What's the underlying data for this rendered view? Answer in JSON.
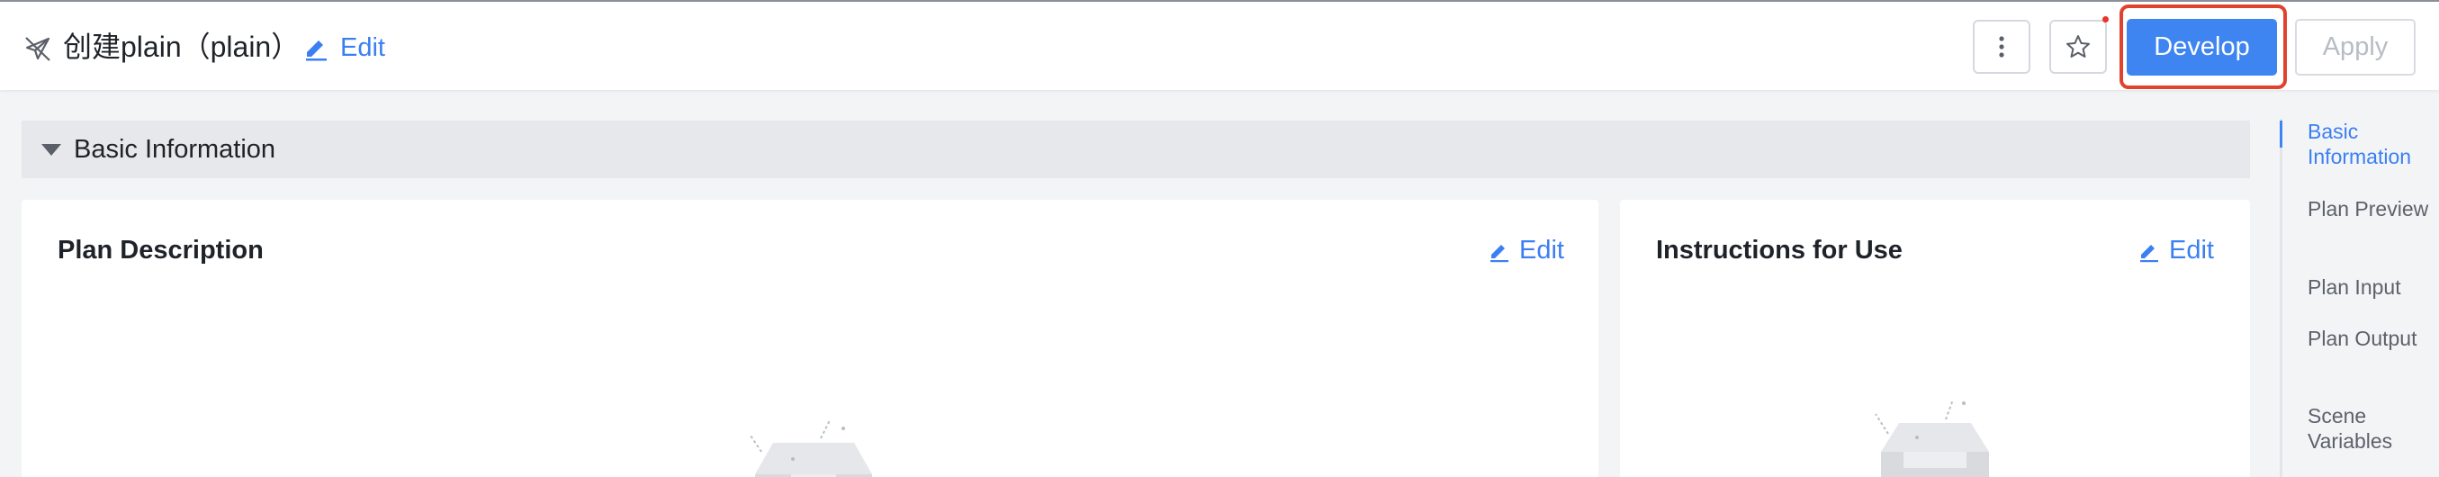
{
  "header": {
    "plan_title": "创建plain（plain）",
    "edit_label": "Edit",
    "develop_label": "Develop",
    "apply_label": "Apply"
  },
  "icons": {
    "plan": "paper-plane-icon",
    "edit": "pencil-icon",
    "more": "more-vertical-icon",
    "star": "star-icon"
  },
  "section": {
    "title": "Basic Information"
  },
  "cards": {
    "description": {
      "title": "Plan Description",
      "edit_label": "Edit"
    },
    "instructions": {
      "title": "Instructions for Use",
      "edit_label": "Edit"
    }
  },
  "anchor_nav": [
    {
      "label": "Basic Information",
      "active": true
    },
    {
      "label": "Plan Preview",
      "active": false
    },
    {
      "label": "Plan Input",
      "active": false
    },
    {
      "label": "Plan Output",
      "active": false
    },
    {
      "label": "Scene Variables",
      "active": false
    }
  ],
  "colors": {
    "accent": "#3f85f2",
    "highlight": "#e0432d",
    "notification_dot": "#e8352a"
  }
}
